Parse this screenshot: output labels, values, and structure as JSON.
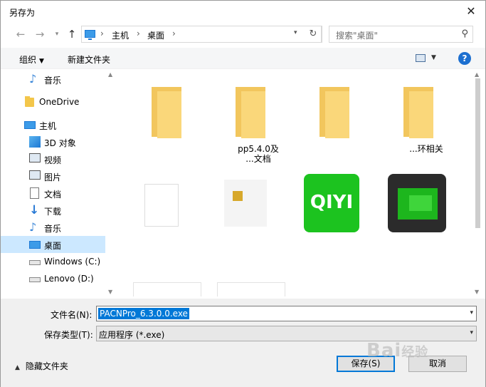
{
  "window": {
    "title": "另存为"
  },
  "address": {
    "crumbs": [
      "主机",
      "桌面"
    ],
    "search_placeholder": "搜索\"桌面\""
  },
  "toolbar": {
    "organize_label": "组织",
    "new_folder_label": "新建文件夹",
    "help": "?"
  },
  "nav": {
    "items": [
      {
        "label": "音乐",
        "icon": "music-icon"
      },
      {
        "label": "OneDrive",
        "icon": "folder-icon"
      },
      {
        "label": "主机",
        "icon": "computer-icon"
      },
      {
        "label": "3D 对象",
        "icon": "3d-objects-icon"
      },
      {
        "label": "视频",
        "icon": "video-icon"
      },
      {
        "label": "图片",
        "icon": "pictures-icon"
      },
      {
        "label": "文档",
        "icon": "documents-icon"
      },
      {
        "label": "下载",
        "icon": "download-icon"
      },
      {
        "label": "音乐",
        "icon": "music-icon"
      },
      {
        "label": "桌面",
        "icon": "desktop-icon"
      },
      {
        "label": "Windows (C:)",
        "icon": "drive-icon"
      },
      {
        "label": "Lenovo (D:)",
        "icon": "drive-icon"
      }
    ]
  },
  "files": [
    {
      "name": "",
      "kind": "folder"
    },
    {
      "name": "pp5.4.0及\n...文档",
      "kind": "folder"
    },
    {
      "name": "",
      "kind": "folder"
    },
    {
      "name": "...环相关",
      "kind": "folder"
    },
    {
      "name": "",
      "kind": "document"
    },
    {
      "name": "",
      "kind": "setup"
    },
    {
      "name": "",
      "kind": "iqiyi",
      "logo_text": "QIYI"
    },
    {
      "name": "",
      "kind": "app"
    }
  ],
  "form": {
    "filename_label": "文件名(N):",
    "filename_value": "PACNPro_6.3.0.0.exe",
    "filetype_label": "保存类型(T):",
    "filetype_value": "应用程序 (*.exe)",
    "hide_folders_label": "隐藏文件夹",
    "save_label": "保存(S)",
    "cancel_label": "取消"
  },
  "watermark": {
    "text": "Bai",
    "sub": "经验"
  }
}
